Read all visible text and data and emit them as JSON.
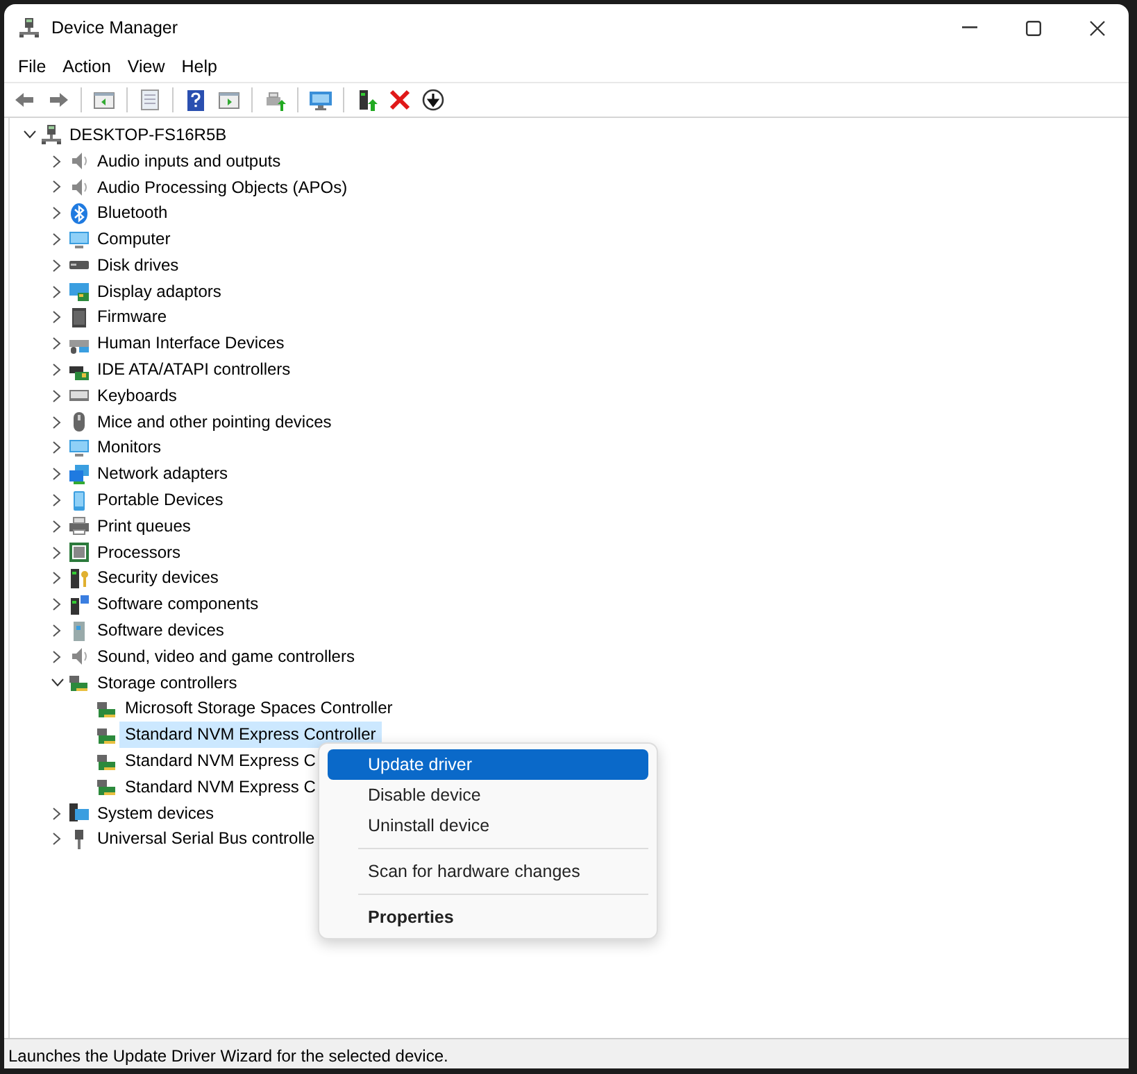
{
  "window": {
    "title": "Device Manager"
  },
  "menu_bar": [
    "File",
    "Action",
    "View",
    "Help"
  ],
  "tree": {
    "label": "DESKTOP-FS16R5B",
    "expanded": true,
    "selected": false,
    "children": [
      {
        "label": "Audio inputs and outputs",
        "expanded": false,
        "selected": false
      },
      {
        "label": "Audio Processing Objects (APOs)",
        "expanded": false,
        "selected": false
      },
      {
        "label": "Bluetooth",
        "expanded": false,
        "selected": false
      },
      {
        "label": "Computer",
        "expanded": false,
        "selected": false
      },
      {
        "label": "Disk drives",
        "expanded": false,
        "selected": false
      },
      {
        "label": "Display adaptors",
        "expanded": false,
        "selected": false
      },
      {
        "label": "Firmware",
        "expanded": false,
        "selected": false
      },
      {
        "label": "Human Interface Devices",
        "expanded": false,
        "selected": false
      },
      {
        "label": "IDE ATA/ATAPI controllers",
        "expanded": false,
        "selected": false
      },
      {
        "label": "Keyboards",
        "expanded": false,
        "selected": false
      },
      {
        "label": "Mice and other pointing devices",
        "expanded": false,
        "selected": false
      },
      {
        "label": "Monitors",
        "expanded": false,
        "selected": false
      },
      {
        "label": "Network adapters",
        "expanded": false,
        "selected": false
      },
      {
        "label": "Portable Devices",
        "expanded": false,
        "selected": false
      },
      {
        "label": "Print queues",
        "expanded": false,
        "selected": false
      },
      {
        "label": "Processors",
        "expanded": false,
        "selected": false
      },
      {
        "label": "Security devices",
        "expanded": false,
        "selected": false
      },
      {
        "label": "Software components",
        "expanded": false,
        "selected": false
      },
      {
        "label": "Software devices",
        "expanded": false,
        "selected": false
      },
      {
        "label": "Sound, video and game controllers",
        "expanded": false,
        "selected": false
      },
      {
        "label": "Storage controllers",
        "expanded": true,
        "selected": false,
        "children": [
          {
            "label": "Microsoft Storage Spaces Controller",
            "selected": false
          },
          {
            "label": "Standard NVM Express Controller",
            "selected": true
          },
          {
            "label": "Standard NVM Express C",
            "selected": false
          },
          {
            "label": "Standard NVM Express C",
            "selected": false
          }
        ]
      },
      {
        "label": "System devices",
        "expanded": false,
        "selected": false
      },
      {
        "label": "Universal Serial Bus controlle",
        "expanded": false,
        "selected": false
      }
    ]
  },
  "context_menu": [
    {
      "kind": "item",
      "label": "Update driver",
      "selected": true,
      "default": false
    },
    {
      "kind": "item",
      "label": "Disable device",
      "selected": false,
      "default": false
    },
    {
      "kind": "item",
      "label": "Uninstall device",
      "selected": false,
      "default": false
    },
    {
      "kind": "separator"
    },
    {
      "kind": "item",
      "label": "Scan for hardware changes",
      "selected": false,
      "default": false
    },
    {
      "kind": "separator"
    },
    {
      "kind": "item",
      "label": "Properties",
      "selected": false,
      "default": true
    }
  ],
  "status_bar": "Launches the Update Driver Wizard for the selected device."
}
